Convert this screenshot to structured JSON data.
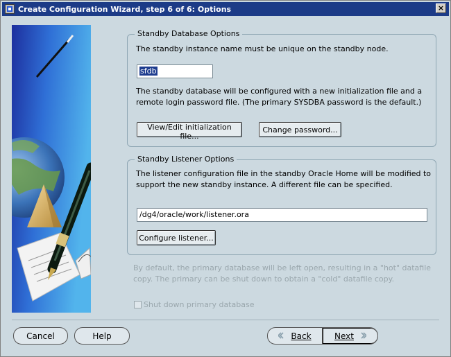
{
  "window": {
    "title": "Create Configuration Wizard, step 6 of 6: Options",
    "close_glyph": "×"
  },
  "standby_db": {
    "legend": "Standby Database Options",
    "instance_note": "The standby instance name must be unique on the standby node.",
    "instance_value": "sfdb",
    "config_note_line1": "The standby database will be configured with a new initialization file and a",
    "config_note_line2": "remote login password file. (The primary SYSDBA password is the default.)",
    "view_edit_button": "View/Edit initialization file...",
    "change_password_button": "Change password..."
  },
  "standby_listener": {
    "legend": "Standby Listener Options",
    "note_line1": "The listener configuration file in the standby Oracle Home will be modified to",
    "note_line2": "support the new standby instance. A different file can be specified.",
    "file_value": "/dg4/oracle/work/listener.ora",
    "configure_button": "Configure listener..."
  },
  "primary": {
    "note_line1": "By default, the primary database will be left open, resulting in a \"hot\" datafile",
    "note_line2": "copy. The primary can be shut down to obtain a \"cold\" datafile copy.",
    "shutdown_label": "Shut down primary database",
    "shutdown_checked": false
  },
  "nav": {
    "cancel": "Cancel",
    "help": "Help",
    "back": "Back",
    "next": "Next"
  },
  "colors": {
    "title_bar": "#1c3b87",
    "panel_bg": "#ccd9e0",
    "selection": "#1f3d8f"
  }
}
